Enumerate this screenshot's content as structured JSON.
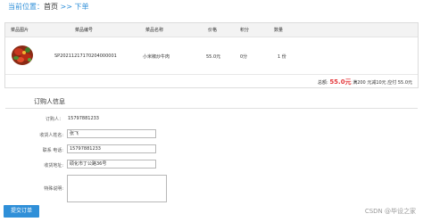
{
  "breadcrumb": {
    "prefix": "当前位置：",
    "home": "首页",
    "separator": ">>",
    "current": "下单"
  },
  "order_table": {
    "columns": [
      "菜品图片",
      "菜品编号",
      "菜品名称",
      "价格",
      "积分",
      "数量"
    ],
    "rows": [
      {
        "image_icon": "food-thumbnail",
        "id": "SP20211217170204000001",
        "name": "小米椒炒牛肉",
        "price": "55.0元",
        "points": "0分",
        "quantity": "1 份"
      }
    ]
  },
  "summary": {
    "total_label": "总额:",
    "total_value": "55.0元",
    "discount_text": "满200 元减10元 应付 55.0元"
  },
  "orderer_section": {
    "title": "订购人信息",
    "orderer_label": "订购人：",
    "orderer_value": "15797881233",
    "recipient_label": "收货人姓名:",
    "recipient_value": "张飞",
    "phone_label": "联系 电话:",
    "phone_value": "15797881233",
    "address_label": "收货地址:",
    "address_value": "硕化市丁公路36号",
    "note_label": "特殊说明:",
    "note_value": ""
  },
  "submit_label": "提交订单",
  "watermark": "CSDN @毕设之家",
  "colors": {
    "accent": "#2f8fd8",
    "price_red": "#e4393c"
  }
}
